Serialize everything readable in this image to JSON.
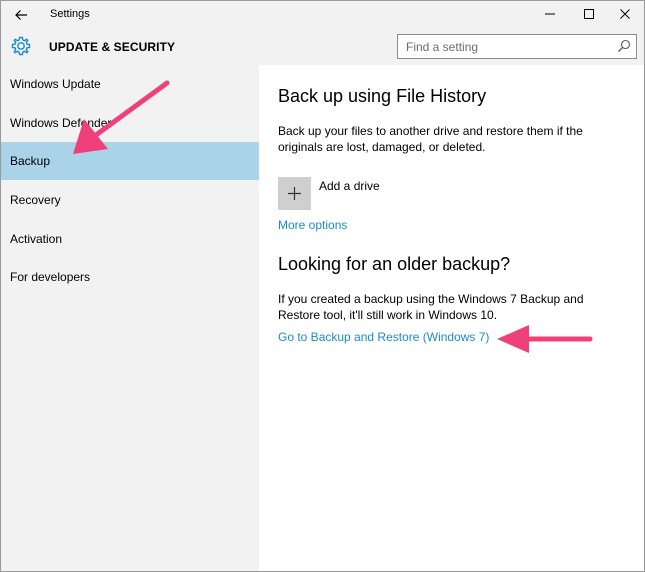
{
  "window": {
    "title": "Settings"
  },
  "header": {
    "section_title": "UPDATE & SECURITY",
    "search_placeholder": "Find a setting"
  },
  "sidebar": {
    "items": [
      {
        "label": "Windows Update",
        "active": false
      },
      {
        "label": "Windows Defender",
        "active": false
      },
      {
        "label": "Backup",
        "active": true
      },
      {
        "label": "Recovery",
        "active": false
      },
      {
        "label": "Activation",
        "active": false
      },
      {
        "label": "For developers",
        "active": false
      }
    ]
  },
  "main": {
    "file_history": {
      "heading": "Back up using File History",
      "description": "Back up your files to another drive and restore them if the originals are lost, damaged, or deleted.",
      "add_drive_label": "Add a drive",
      "more_options_link": "More options"
    },
    "older_backup": {
      "heading": "Looking for an older backup?",
      "description": "If you created a backup using the Windows 7 Backup and Restore tool, it'll still work in Windows 10.",
      "link": "Go to Backup and Restore (Windows 7)"
    }
  },
  "colors": {
    "accent": "#1a8bc9",
    "selected_nav": "#abd3e8",
    "annotation_arrow": "#f0407a",
    "chrome_bg": "#f2f2f2"
  },
  "icons": {
    "back": "arrow-left",
    "settings": "gear",
    "search": "magnifier",
    "add": "plus"
  }
}
